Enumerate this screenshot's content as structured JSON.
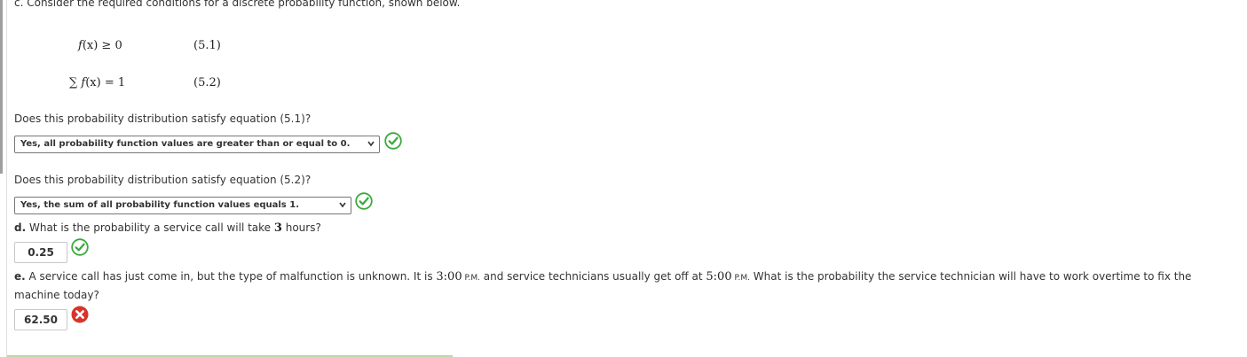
{
  "part_c": {
    "intro": "c. Consider the required conditions for a discrete probability function, shown below.",
    "eq1": {
      "expr_f": "f",
      "expr_rest": "(x) ≥ 0",
      "number": "(5.1)"
    },
    "eq2": {
      "expr_sigma": "∑",
      "expr_f": "f",
      "expr_rest": "(x) = 1",
      "number": "(5.2)"
    },
    "q1": {
      "question": "Does this probability distribution satisfy equation (5.1)?",
      "selected": "Yes, all probability function values are greater than or equal to 0.",
      "status": "correct"
    },
    "q2": {
      "question": "Does this probability distribution satisfy equation (5.2)?",
      "selected": "Yes, the sum of all probability function values equals 1.",
      "status": "correct"
    }
  },
  "part_d": {
    "label": "d.",
    "question_pre": " What is the probability a service call will take ",
    "hours_value": "3",
    "question_post": " hours?",
    "answer": "0.25",
    "status": "correct"
  },
  "part_e": {
    "label": "e.",
    "text_1": " A service call has just come in, but the type of malfunction is unknown. It is ",
    "time_1": "3:00",
    "pm_1": " P.M.",
    "text_2": " and service technicians usually get off at ",
    "time_2": "5:00",
    "pm_2": " P.M.",
    "text_3": " What is the probability the service technician will have to work overtime to fix the",
    "line_2": "machine today?",
    "answer": "62.50",
    "status": "incorrect"
  },
  "colors": {
    "correct": "#3aa93a",
    "incorrect": "#d9342b"
  },
  "icons": {
    "correct": "check-circle-icon",
    "incorrect": "x-circle-icon",
    "dropdown": "chevron-down-icon"
  }
}
